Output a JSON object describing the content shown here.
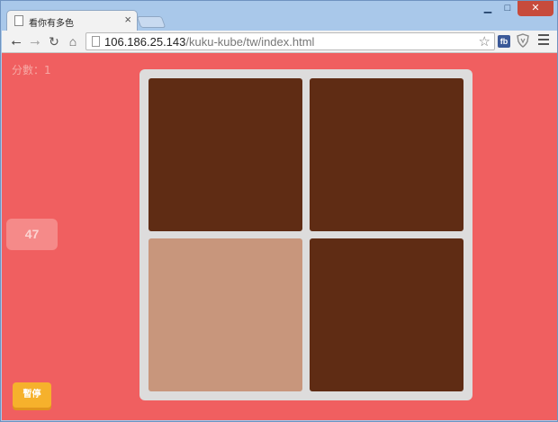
{
  "browser": {
    "tab_title": "看你有多色",
    "tab_close": "×",
    "url_host": "106.186.25.143",
    "url_path": "/kuku-kube/tw/index.html",
    "fb_label": "fb"
  },
  "game": {
    "score_text": "分數：1",
    "timer": "47",
    "pause_label": "暫停",
    "base_color": "#5f2c14",
    "odd_color": "#c8967c",
    "cells": [
      {
        "color": "#5f2c14"
      },
      {
        "color": "#5f2c14"
      },
      {
        "color": "#c8967c"
      },
      {
        "color": "#5f2c14"
      }
    ]
  }
}
